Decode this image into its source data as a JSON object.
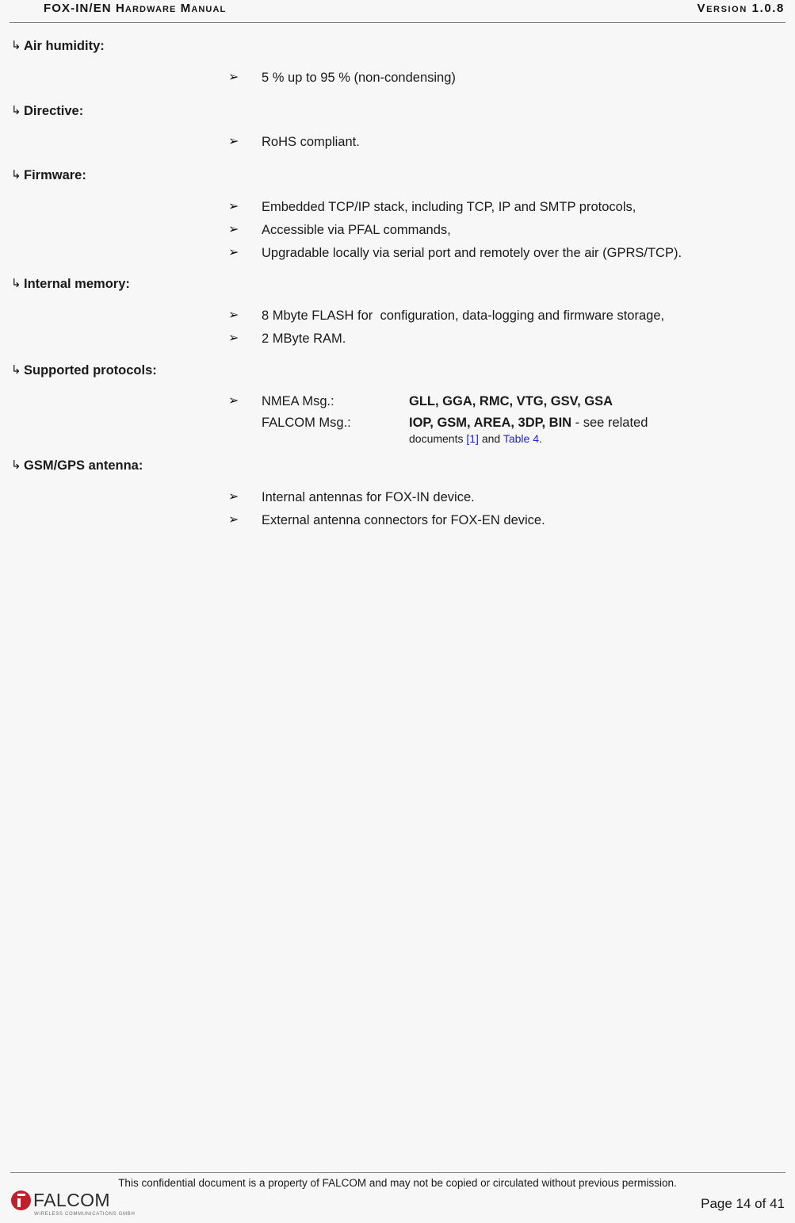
{
  "header": {
    "left_title": "FOX-IN/EN Hardware Manual",
    "right_version": "Version 1.0.8"
  },
  "icons": {
    "level1_bullet": "↳",
    "level2_bullet": "➢"
  },
  "sections": [
    {
      "heading": "Air humidity:",
      "items": [
        {
          "text": "5 % up to 95 % (non-condensing)"
        }
      ]
    },
    {
      "heading": "Directive:",
      "items": [
        {
          "text": "RoHS compliant."
        }
      ]
    },
    {
      "heading": "Firmware:",
      "items": [
        {
          "text": "Embedded TCP/IP stack, including TCP, IP and SMTP protocols,"
        },
        {
          "text": "Accessible via PFAL commands,"
        },
        {
          "text": "Upgradable locally via serial port and remotely over the air (GPRS/TCP)."
        }
      ]
    },
    {
      "heading": "Internal memory:",
      "items": [
        {
          "text": "8 Mbyte FLASH for  configuration, data-logging and firmware storage,"
        },
        {
          "text": "2 MByte RAM."
        }
      ]
    },
    {
      "heading": "Supported protocols:",
      "protocols": [
        {
          "label": "NMEA Msg.:",
          "value": "GLL, GGA, RMC, VTG, GSV, GSA"
        },
        {
          "label": "FALCOM Msg.:",
          "value": "IOP, GSM, AREA, 3DP, BIN",
          "suffix": " - see related",
          "note_prefix": "documents ",
          "note_link1": "[1]",
          "note_middle": " and ",
          "note_link2": "Table 4",
          "note_suffix": "."
        }
      ]
    },
    {
      "heading": "GSM/GPS antenna:",
      "items": [
        {
          "text": "Internal antennas for FOX-IN device."
        },
        {
          "text": "External antenna connectors for FOX-EN device."
        }
      ]
    }
  ],
  "footer": {
    "confidential_note": "This confidential document is a property of FALCOM and may not be copied or circulated without previous permission.",
    "page_label": "Page 14 of 41",
    "logo_word": "FALCOM",
    "logo_subtitle": "WIRELESS COMMUNICATIONS GMBH"
  },
  "colors": {
    "page_background": "#f7f7f7",
    "text": "#1a1a1a",
    "link": "#2222dd",
    "rule": "#7f7f7f",
    "logo_red": "#c0202c"
  }
}
